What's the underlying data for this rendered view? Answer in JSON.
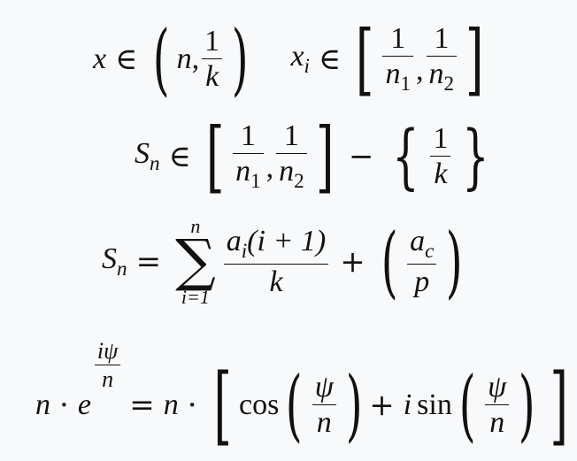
{
  "equations": [
    {
      "id": "eq1",
      "latex": "x \\in \\left(n, \\frac{1}{k}\\right) \\quad x_i \\in \\left[\\frac{1}{n_1}, \\frac{1}{n_2}\\right]",
      "parts": {
        "x": "x",
        "in": "∈",
        "n": "n",
        "comma": ",",
        "one": "1",
        "k": "k",
        "xi_base": "x",
        "xi_sub": "i",
        "n1_base": "n",
        "n1_sub": "1",
        "n2_base": "n",
        "n2_sub": "2",
        "lparen": "(",
        "rparen": ")",
        "lbrack": "[",
        "rbrack": "]"
      }
    },
    {
      "id": "eq2",
      "latex": "S_n \\in \\left[\\frac{1}{n_1}, \\frac{1}{n_2}\\right] - \\left\\{\\frac{1}{k}\\right\\}",
      "parts": {
        "S": "S",
        "S_sub": "n",
        "in": "∈",
        "minus": "−",
        "lbrace": "{",
        "rbrace": "}"
      }
    },
    {
      "id": "eq3",
      "latex": "S_n = \\sum_{i=1}^{n} \\frac{a_i(i+1)}{k} + \\left(\\frac{a_c}{p}\\right)",
      "parts": {
        "eq": "=",
        "sigma": "∑",
        "upper": "n",
        "lower": "i=1",
        "a": "a",
        "a_sub_i": "i",
        "num_rest": "(i + 1)",
        "k": "k",
        "plus": "+",
        "a_sub_c": "c",
        "p": "p"
      }
    },
    {
      "id": "eq4",
      "latex": "n \\cdot e^{\\frac{i\\psi}{n}} = n \\cdot \\left[\\cos\\left(\\frac{\\psi}{n}\\right) + i\\sin\\left(\\frac{\\psi}{n}\\right)\\right]",
      "parts": {
        "n": "n",
        "cdot": "·",
        "e": "e",
        "ipsi": "iψ",
        "psi": "ψ",
        "eq": "=",
        "cos": "cos",
        "plus": "+",
        "i": "i",
        "sin": "sin"
      }
    }
  ]
}
